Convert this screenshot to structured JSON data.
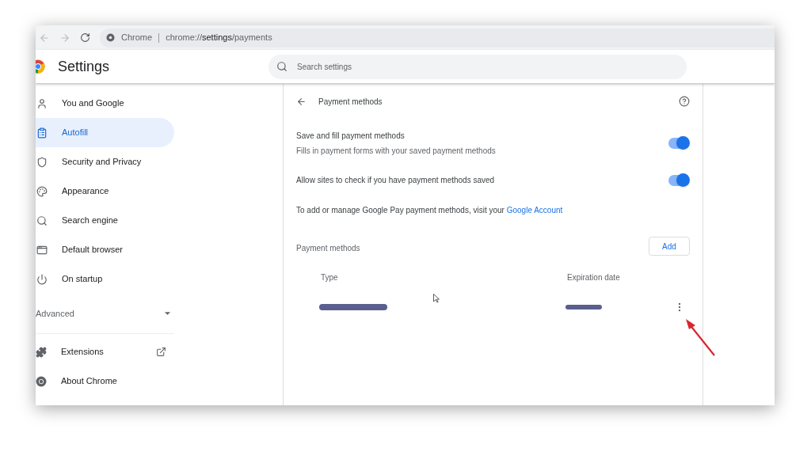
{
  "browser": {
    "site_label": "Chrome",
    "url_host": "chrome://",
    "url_path": "settings",
    "url_rest": "/payments"
  },
  "header": {
    "title": "Settings",
    "search": {
      "placeholder": "Search settings"
    }
  },
  "sidebar": {
    "items": [
      {
        "label": "You and Google",
        "selected": false
      },
      {
        "label": "Autofill",
        "selected": true
      },
      {
        "label": "Security and Privacy",
        "selected": false
      },
      {
        "label": "Appearance",
        "selected": false
      },
      {
        "label": "Search engine",
        "selected": false
      },
      {
        "label": "Default browser",
        "selected": false
      },
      {
        "label": "On startup",
        "selected": false
      }
    ],
    "advanced": {
      "label": "Advanced",
      "expanded": false
    },
    "extra_items": [
      {
        "label": "Extensions",
        "external": true
      },
      {
        "label": "About Chrome",
        "external": false
      }
    ]
  },
  "panel": {
    "title": "Payment methods",
    "toggles": [
      {
        "label": "Save and fill payment methods",
        "description": "Fills in payment forms with your saved payment methods",
        "on": true
      },
      {
        "label": "Allow sites to check if you have payment methods saved",
        "on": true
      }
    ],
    "note": "To add or manage Google Pay payment methods, visit your",
    "note_link": "Google Account",
    "section_title": "Payment methods",
    "add_button": "Add",
    "columns": [
      "Type",
      "Expiration date"
    ]
  }
}
